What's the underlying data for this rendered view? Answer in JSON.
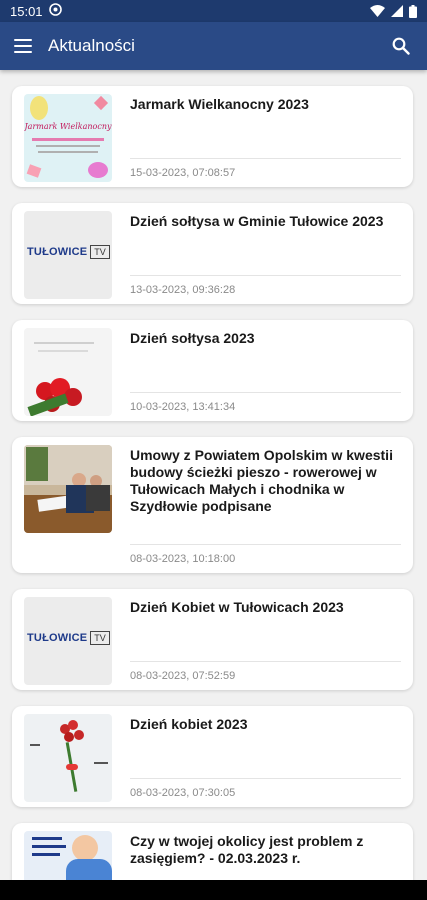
{
  "status_bar": {
    "time": "15:01",
    "icons": [
      "sync-icon",
      "wifi-icon",
      "signal-icon",
      "battery-icon"
    ]
  },
  "app_bar": {
    "title": "Aktualności",
    "menu_icon": "hamburger-menu-icon",
    "search_icon": "search-icon"
  },
  "colors": {
    "status_bar": "#1e3a6e",
    "app_bar": "#2a4a86",
    "background": "#f1f1f1",
    "tv_blue": "#1e3a8a"
  },
  "articles": [
    {
      "title": "Jarmark Wielkanocny 2023",
      "date": "15-03-2023, 07:08:57",
      "thumb_text": "Jarmark Wielkanocny"
    },
    {
      "title": "Dzień sołtysa w Gminie Tułowice 2023",
      "date": "13-03-2023, 09:36:28",
      "thumb_text": "TUŁOWICE",
      "thumb_badge": "TV"
    },
    {
      "title": "Dzień sołtysa 2023",
      "date": "10-03-2023, 13:41:34"
    },
    {
      "title": "Umowy z Powiatem Opolskim w kwestii budowy ścieżki pieszo - rowerowej w Tułowicach Małych i chodnika w Szydłowie podpisane",
      "date": "08-03-2023, 10:18:00"
    },
    {
      "title": "Dzień Kobiet w Tułowicach 2023",
      "date": "08-03-2023, 07:52:59",
      "thumb_text": "TUŁOWICE",
      "thumb_badge": "TV"
    },
    {
      "title": "Dzień kobiet 2023",
      "date": "08-03-2023, 07:30:05"
    },
    {
      "title": "Czy w twojej okolicy jest problem z zasięgiem? - 02.03.2023 r.",
      "date": ""
    }
  ]
}
